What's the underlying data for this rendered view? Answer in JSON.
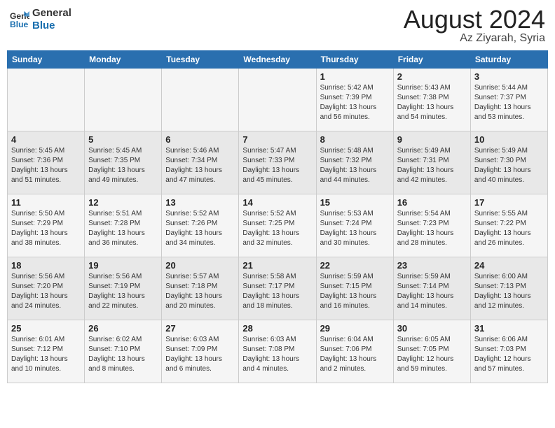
{
  "header": {
    "logo_line1": "General",
    "logo_line2": "Blue",
    "month": "August 2024",
    "location": "Az Ziyarah, Syria"
  },
  "weekdays": [
    "Sunday",
    "Monday",
    "Tuesday",
    "Wednesday",
    "Thursday",
    "Friday",
    "Saturday"
  ],
  "weeks": [
    [
      {
        "day": "",
        "info": ""
      },
      {
        "day": "",
        "info": ""
      },
      {
        "day": "",
        "info": ""
      },
      {
        "day": "",
        "info": ""
      },
      {
        "day": "1",
        "info": "Sunrise: 5:42 AM\nSunset: 7:39 PM\nDaylight: 13 hours\nand 56 minutes."
      },
      {
        "day": "2",
        "info": "Sunrise: 5:43 AM\nSunset: 7:38 PM\nDaylight: 13 hours\nand 54 minutes."
      },
      {
        "day": "3",
        "info": "Sunrise: 5:44 AM\nSunset: 7:37 PM\nDaylight: 13 hours\nand 53 minutes."
      }
    ],
    [
      {
        "day": "4",
        "info": "Sunrise: 5:45 AM\nSunset: 7:36 PM\nDaylight: 13 hours\nand 51 minutes."
      },
      {
        "day": "5",
        "info": "Sunrise: 5:45 AM\nSunset: 7:35 PM\nDaylight: 13 hours\nand 49 minutes."
      },
      {
        "day": "6",
        "info": "Sunrise: 5:46 AM\nSunset: 7:34 PM\nDaylight: 13 hours\nand 47 minutes."
      },
      {
        "day": "7",
        "info": "Sunrise: 5:47 AM\nSunset: 7:33 PM\nDaylight: 13 hours\nand 45 minutes."
      },
      {
        "day": "8",
        "info": "Sunrise: 5:48 AM\nSunset: 7:32 PM\nDaylight: 13 hours\nand 44 minutes."
      },
      {
        "day": "9",
        "info": "Sunrise: 5:49 AM\nSunset: 7:31 PM\nDaylight: 13 hours\nand 42 minutes."
      },
      {
        "day": "10",
        "info": "Sunrise: 5:49 AM\nSunset: 7:30 PM\nDaylight: 13 hours\nand 40 minutes."
      }
    ],
    [
      {
        "day": "11",
        "info": "Sunrise: 5:50 AM\nSunset: 7:29 PM\nDaylight: 13 hours\nand 38 minutes."
      },
      {
        "day": "12",
        "info": "Sunrise: 5:51 AM\nSunset: 7:28 PM\nDaylight: 13 hours\nand 36 minutes."
      },
      {
        "day": "13",
        "info": "Sunrise: 5:52 AM\nSunset: 7:26 PM\nDaylight: 13 hours\nand 34 minutes."
      },
      {
        "day": "14",
        "info": "Sunrise: 5:52 AM\nSunset: 7:25 PM\nDaylight: 13 hours\nand 32 minutes."
      },
      {
        "day": "15",
        "info": "Sunrise: 5:53 AM\nSunset: 7:24 PM\nDaylight: 13 hours\nand 30 minutes."
      },
      {
        "day": "16",
        "info": "Sunrise: 5:54 AM\nSunset: 7:23 PM\nDaylight: 13 hours\nand 28 minutes."
      },
      {
        "day": "17",
        "info": "Sunrise: 5:55 AM\nSunset: 7:22 PM\nDaylight: 13 hours\nand 26 minutes."
      }
    ],
    [
      {
        "day": "18",
        "info": "Sunrise: 5:56 AM\nSunset: 7:20 PM\nDaylight: 13 hours\nand 24 minutes."
      },
      {
        "day": "19",
        "info": "Sunrise: 5:56 AM\nSunset: 7:19 PM\nDaylight: 13 hours\nand 22 minutes."
      },
      {
        "day": "20",
        "info": "Sunrise: 5:57 AM\nSunset: 7:18 PM\nDaylight: 13 hours\nand 20 minutes."
      },
      {
        "day": "21",
        "info": "Sunrise: 5:58 AM\nSunset: 7:17 PM\nDaylight: 13 hours\nand 18 minutes."
      },
      {
        "day": "22",
        "info": "Sunrise: 5:59 AM\nSunset: 7:15 PM\nDaylight: 13 hours\nand 16 minutes."
      },
      {
        "day": "23",
        "info": "Sunrise: 5:59 AM\nSunset: 7:14 PM\nDaylight: 13 hours\nand 14 minutes."
      },
      {
        "day": "24",
        "info": "Sunrise: 6:00 AM\nSunset: 7:13 PM\nDaylight: 13 hours\nand 12 minutes."
      }
    ],
    [
      {
        "day": "25",
        "info": "Sunrise: 6:01 AM\nSunset: 7:12 PM\nDaylight: 13 hours\nand 10 minutes."
      },
      {
        "day": "26",
        "info": "Sunrise: 6:02 AM\nSunset: 7:10 PM\nDaylight: 13 hours\nand 8 minutes."
      },
      {
        "day": "27",
        "info": "Sunrise: 6:03 AM\nSunset: 7:09 PM\nDaylight: 13 hours\nand 6 minutes."
      },
      {
        "day": "28",
        "info": "Sunrise: 6:03 AM\nSunset: 7:08 PM\nDaylight: 13 hours\nand 4 minutes."
      },
      {
        "day": "29",
        "info": "Sunrise: 6:04 AM\nSunset: 7:06 PM\nDaylight: 13 hours\nand 2 minutes."
      },
      {
        "day": "30",
        "info": "Sunrise: 6:05 AM\nSunset: 7:05 PM\nDaylight: 12 hours\nand 59 minutes."
      },
      {
        "day": "31",
        "info": "Sunrise: 6:06 AM\nSunset: 7:03 PM\nDaylight: 12 hours\nand 57 minutes."
      }
    ]
  ]
}
